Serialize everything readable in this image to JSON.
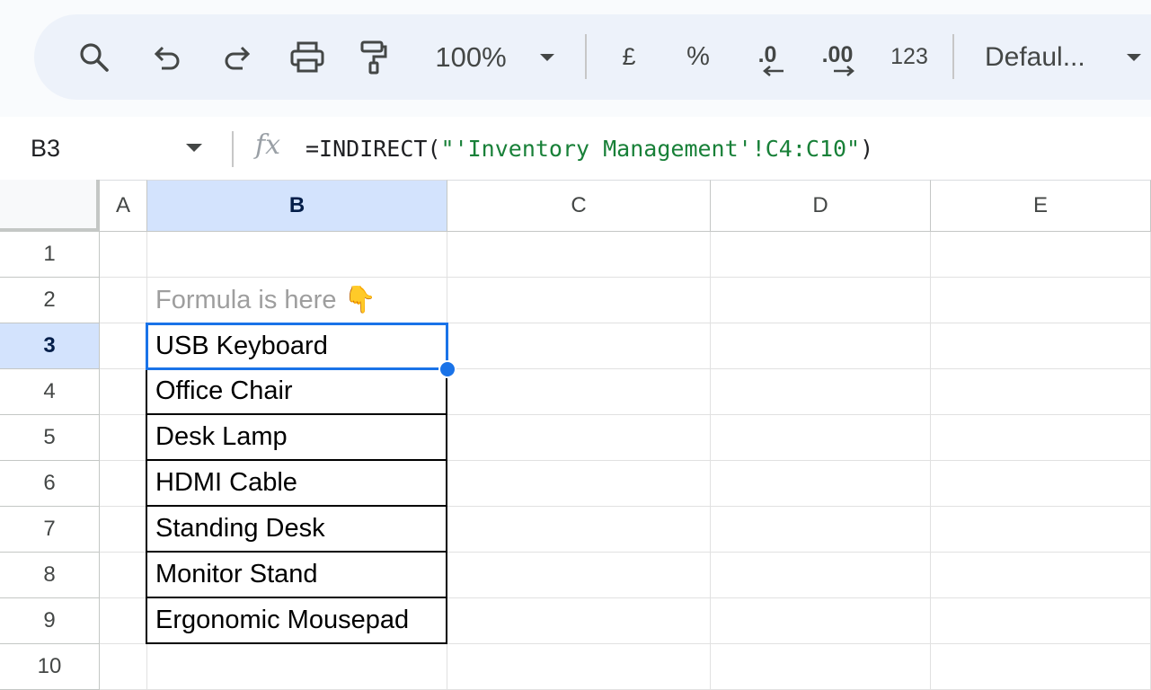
{
  "toolbar": {
    "zoom": "100%",
    "currency": "£",
    "percent": "%",
    "decrease_decimal": ".0",
    "increase_decimal": ".00",
    "number_format": "123",
    "font": "Defaul..."
  },
  "formula_bar": {
    "name_box": "B3",
    "fx": "fx",
    "formula_prefix": "=INDIRECT(",
    "formula_string": "\"'Inventory Management'!C4:C10\"",
    "formula_suffix": ")"
  },
  "columns": [
    "A",
    "B",
    "C",
    "D",
    "E"
  ],
  "rows": [
    "1",
    "2",
    "3",
    "4",
    "5",
    "6",
    "7",
    "8",
    "9",
    "10"
  ],
  "cells": {
    "b2": "Formula is here 👇",
    "b3": "USB Keyboard",
    "b4": "Office Chair",
    "b5": "Desk Lamp",
    "b6": "HDMI Cable",
    "b7": "Standing Desk",
    "b8": "Monitor Stand",
    "b9": "Ergonomic Mousepad"
  },
  "colors": {
    "selection": "#1a73e8",
    "header_selected": "#d3e3fd",
    "formula_string": "#188038"
  }
}
